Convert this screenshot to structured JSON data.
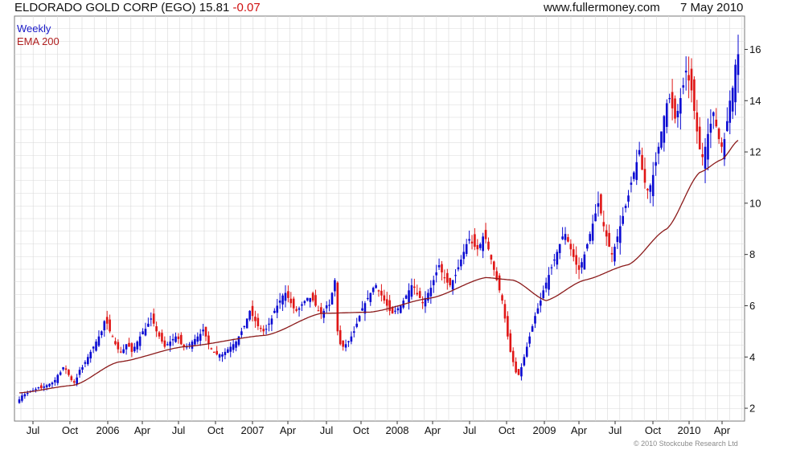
{
  "header": {
    "title": "ELDORADO GOLD CORP (EGO)",
    "last": "15.81",
    "change": "-0.07",
    "site": "www.fullermoney.com",
    "date": "7 May 2010"
  },
  "legend": {
    "weekly": "Weekly",
    "ema": "EMA 200"
  },
  "copyright": "© 2010 Stockcube Research Ltd",
  "colors": {
    "up": "#0a0ad2",
    "down": "#e01616",
    "ema": "#8b1a1a",
    "grid": "#d8d8d8"
  },
  "chart_data": {
    "type": "candlestick",
    "title": "ELDORADO GOLD CORP (EGO)",
    "frequency": "weekly",
    "x_tick_labels": [
      "Jul",
      "Oct",
      "2006",
      "Apr",
      "Jul",
      "Oct",
      "2007",
      "Apr",
      "Jul",
      "Oct",
      "2008",
      "Apr",
      "Jul",
      "Oct",
      "2009",
      "Apr",
      "Jul",
      "Oct",
      "2010",
      "Apr"
    ],
    "x_range": [
      "2005-05",
      "2010-05"
    ],
    "y_ticks": [
      2,
      4,
      6,
      8,
      10,
      12,
      14,
      16
    ],
    "ylim": [
      1.5,
      17.3
    ],
    "y_axis_side": "right",
    "grid": true,
    "series": [
      {
        "name": "Weekly",
        "style": "candles",
        "closes": [
          2.35,
          2.5,
          2.55,
          2.6,
          2.65,
          2.7,
          2.75,
          2.8,
          2.78,
          2.85,
          2.9,
          2.95,
          3.0,
          3.1,
          3.3,
          3.4,
          3.6,
          3.5,
          3.3,
          3.1,
          3.0,
          3.2,
          3.5,
          3.6,
          3.8,
          4.0,
          4.2,
          4.4,
          4.6,
          4.8,
          5.0,
          5.4,
          5.3,
          5.0,
          4.8,
          4.5,
          4.3,
          4.2,
          4.3,
          4.5,
          4.4,
          4.2,
          4.4,
          4.6,
          4.8,
          5.0,
          5.1,
          5.3,
          5.5,
          5.3,
          5.0,
          4.8,
          4.6,
          4.4,
          4.5,
          4.6,
          4.7,
          4.8,
          4.7,
          4.5,
          4.4,
          4.4,
          4.5,
          4.6,
          4.7,
          4.8,
          4.9,
          5.0,
          4.8,
          4.5,
          4.3,
          4.2,
          4.1,
          4.1,
          4.1,
          4.2,
          4.3,
          4.4,
          4.5,
          4.6,
          4.8,
          5.0,
          5.2,
          5.5,
          5.8,
          5.6,
          5.4,
          5.2,
          5.1,
          5.0,
          5.1,
          5.3,
          5.5,
          5.8,
          6.0,
          6.2,
          6.4,
          6.5,
          6.3,
          6.1,
          5.9,
          5.8,
          5.9,
          6.0,
          6.1,
          6.2,
          6.3,
          6.2,
          6.0,
          5.8,
          5.7,
          5.8,
          5.9,
          6.0,
          6.5,
          7.0,
          5.0,
          4.5,
          4.4,
          4.5,
          4.6,
          4.8,
          5.0,
          5.3,
          5.6,
          5.9,
          6.1,
          6.3,
          6.5,
          6.7,
          6.8,
          6.6,
          6.4,
          6.2,
          6.0,
          5.8,
          5.7,
          5.8,
          5.9,
          6.0,
          6.2,
          6.4,
          6.6,
          6.8,
          6.7,
          6.5,
          6.3,
          6.1,
          6.3,
          6.5,
          6.7,
          7.0,
          7.3,
          7.5,
          7.3,
          7.1,
          6.9,
          6.8,
          7.0,
          7.2,
          7.5,
          7.8,
          8.1,
          8.4,
          8.6,
          8.5,
          8.3,
          8.2,
          8.4,
          8.7,
          8.6,
          8.2,
          7.8,
          7.4,
          7.0,
          6.6,
          6.2,
          5.5,
          4.8,
          4.2,
          3.8,
          3.4,
          3.3,
          3.6,
          4.0,
          4.4,
          4.8,
          5.2,
          5.6,
          5.9,
          6.2,
          6.6,
          6.9,
          7.2,
          7.5,
          7.8,
          8.1,
          8.4,
          8.7,
          8.8,
          8.5,
          8.2,
          7.9,
          7.6,
          7.4,
          7.7,
          8.0,
          8.4,
          8.8,
          9.2,
          9.6,
          10.0,
          9.6,
          9.1,
          8.7,
          8.3,
          8.0,
          8.3,
          8.7,
          9.1,
          9.5,
          9.9,
          10.3,
          10.8,
          11.2,
          11.6,
          11.9,
          11.3,
          10.8,
          10.5,
          10.7,
          11.1,
          11.6,
          12.2,
          12.8,
          13.4,
          13.9,
          14.1,
          13.7,
          13.3,
          13.6,
          14.1,
          14.6,
          15.1,
          15.0,
          14.4,
          13.6,
          12.8,
          12.1,
          11.8,
          12.2,
          12.7,
          13.1,
          13.4,
          13.0,
          12.5,
          12.2,
          12.5,
          13.2,
          14.0,
          14.5,
          15.4,
          15.81
        ],
        "last": 15.81
      },
      {
        "name": "EMA 200",
        "style": "line",
        "points": [
          {
            "week": 0,
            "value": 2.6
          },
          {
            "week": 20,
            "value": 2.9
          },
          {
            "week": 36,
            "value": 3.8
          },
          {
            "week": 60,
            "value": 4.4
          },
          {
            "week": 90,
            "value": 4.85
          },
          {
            "week": 110,
            "value": 5.7
          },
          {
            "week": 128,
            "value": 5.75
          },
          {
            "week": 150,
            "value": 6.3
          },
          {
            "week": 170,
            "value": 7.1
          },
          {
            "week": 180,
            "value": 7.0
          },
          {
            "week": 192,
            "value": 6.2
          },
          {
            "week": 206,
            "value": 7.0
          },
          {
            "week": 222,
            "value": 7.6
          },
          {
            "week": 236,
            "value": 9.0
          },
          {
            "week": 248,
            "value": 11.2
          },
          {
            "week": 256,
            "value": 11.7
          },
          {
            "week": 262,
            "value": 12.45
          }
        ]
      }
    ]
  }
}
